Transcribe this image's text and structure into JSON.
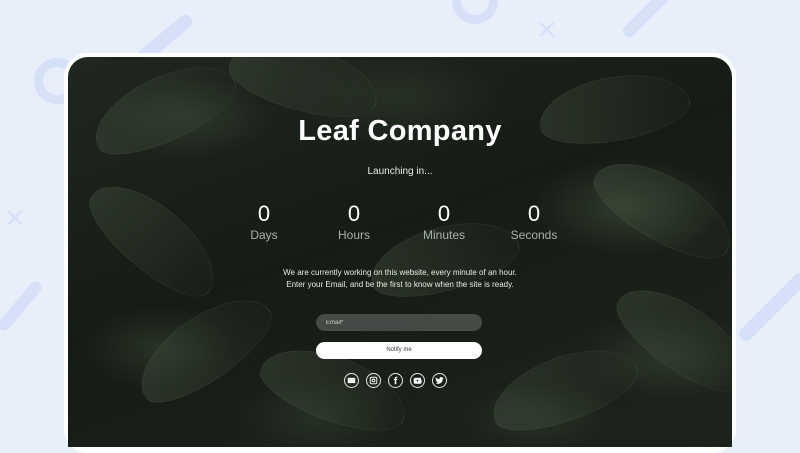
{
  "page": {
    "title": "Leaf Company",
    "launching": "Launching in...",
    "countdown": [
      {
        "value": "0",
        "label": "Days"
      },
      {
        "value": "0",
        "label": "Hours"
      },
      {
        "value": "0",
        "label": "Minutes"
      },
      {
        "value": "0",
        "label": "Seconds"
      }
    ],
    "message_line1": "We are currently working on this website, every minute of an hour.",
    "message_line2": "Enter your Email, and be the first to know when the site is ready.",
    "email_placeholder": "Email*",
    "email_value": "",
    "notify_label": "Notify me",
    "socials": [
      "mail-icon",
      "instagram-icon",
      "facebook-icon",
      "youtube-icon",
      "twitter-icon"
    ]
  },
  "colors": {
    "backdrop": "#e9eefb",
    "decoration": "#d6e0f8",
    "hero_dark": "#1a201a",
    "text": "#ffffff",
    "muted_label": "#a9b2a8",
    "button_bg": "#ffffff"
  }
}
